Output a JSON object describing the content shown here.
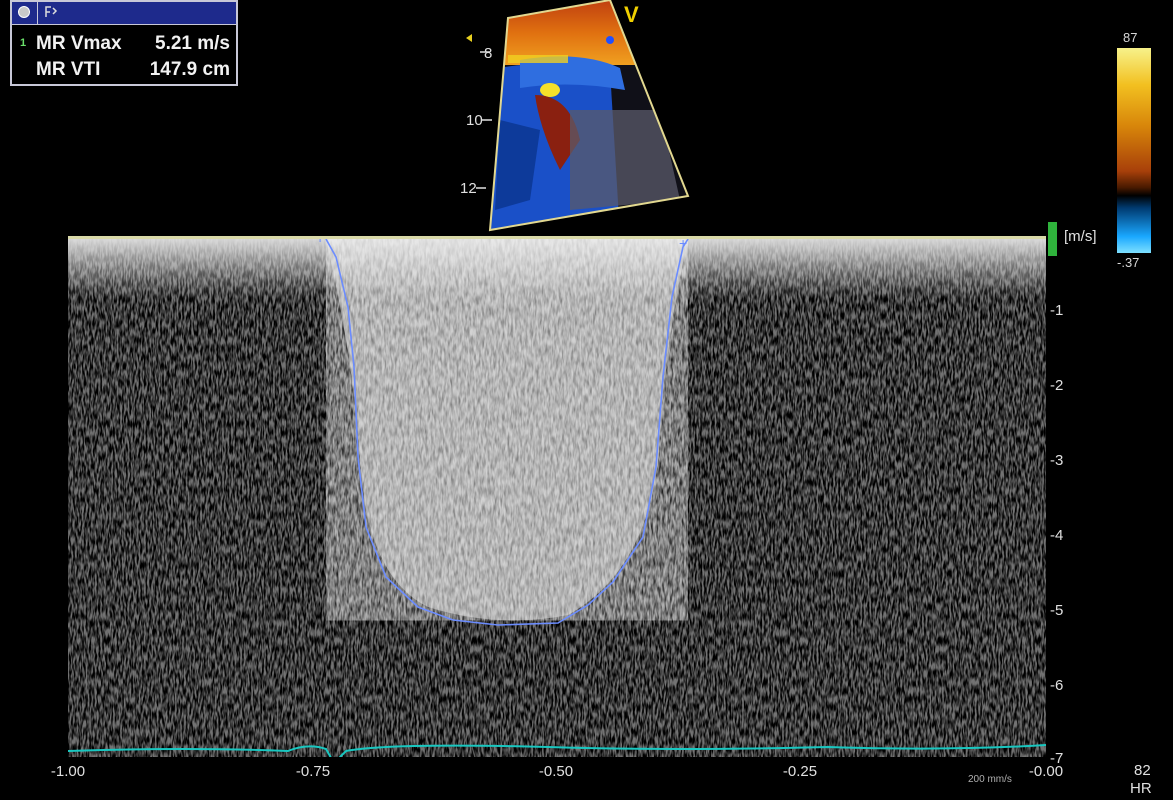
{
  "measurements": [
    {
      "index": "1",
      "name": "MR Vmax",
      "value": "5.21 m/s"
    },
    {
      "index": "",
      "name": "MR VTI",
      "value": "147.9 cm"
    }
  ],
  "sector": {
    "depth_labels": [
      "8",
      "10",
      "12"
    ],
    "view_label": "V"
  },
  "color_scale": {
    "top": "87",
    "bottom": "-.37"
  },
  "spectral": {
    "unit": "[m/s]",
    "y_ticks": [
      "-1",
      "-2",
      "-3",
      "-4",
      "-5",
      "-6",
      "-7"
    ],
    "x_ticks": [
      "-1.00",
      "-0.75",
      "-0.50",
      "-0.25",
      "-0.00"
    ],
    "sweep_speed": "200 mm/s"
  },
  "heart_rate": {
    "value": "82",
    "label": "HR"
  },
  "colors": {
    "trace": "#6b8cff",
    "ecg": "#19c7c0",
    "marker": "#2fb33c"
  }
}
